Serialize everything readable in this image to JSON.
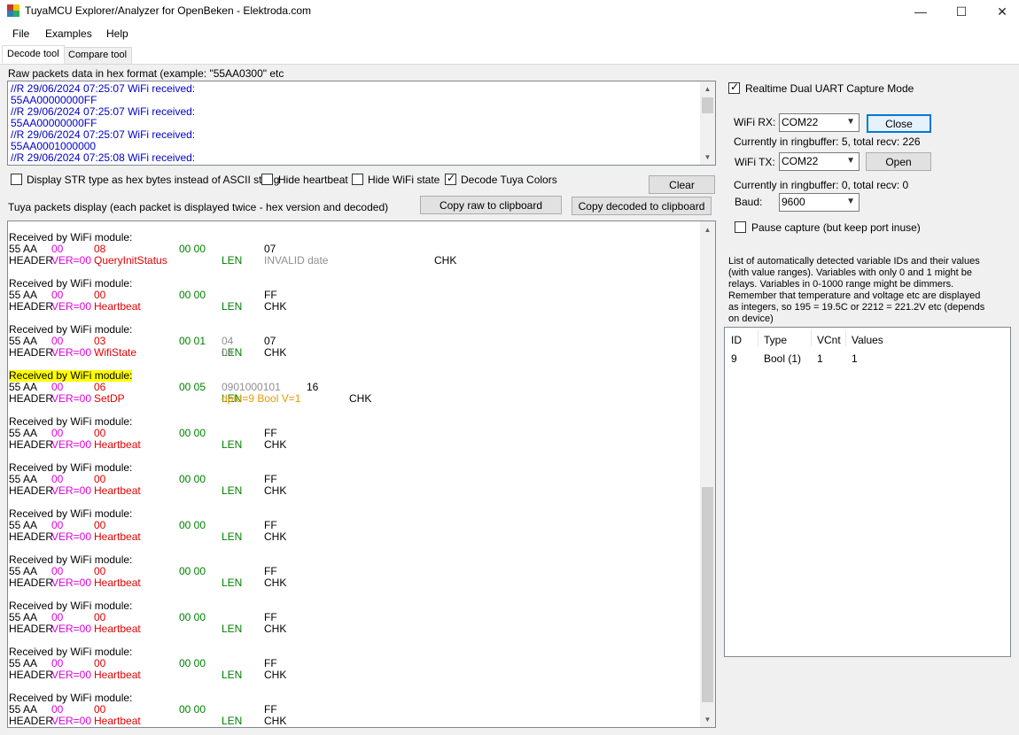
{
  "window": {
    "title": "TuyaMCU Explorer/Analyzer for OpenBeken - Elektroda.com",
    "controls": {
      "minimize": "—",
      "maximize": "☐",
      "close": "✕"
    }
  },
  "menu": [
    "File",
    "Examples",
    "Help"
  ],
  "tabs": [
    "Decode tool",
    "Compare tool"
  ],
  "raw": {
    "label": "Raw packets data in hex format (example: \"55AA0300\" etc",
    "lines": [
      "//R 29/06/2024 07:25:07 WiFi received:",
      "55AA00000000FF",
      "//R 29/06/2024 07:25:07 WiFi received:",
      "55AA00000000FF",
      "//R 29/06/2024 07:25:07 WiFi received:",
      "55AA0001000000",
      "//R 29/06/2024 07:25:08 WiFi received:"
    ]
  },
  "options": {
    "str_hex": "Display STR type as hex bytes instead of ASCII string",
    "hide_heartbeat": "Hide heartbeat",
    "hide_wifi_state": "Hide WiFi state",
    "decode_colors": "Decode Tuya Colors",
    "decode_colors_checked": true
  },
  "buttons": {
    "clear": "Clear",
    "copy_raw": "Copy raw to clipboard",
    "copy_decoded": "Copy decoded to clipboard"
  },
  "packets_label": "Tuya packets display (each packet is displayed twice - hex version and decoded)",
  "packets": [
    {
      "title": "Received by WiFi module:",
      "highlight": false,
      "hex": [
        "55 AA",
        "00",
        "08",
        "00 00",
        "",
        "07",
        ""
      ],
      "dec": [
        "HEADER",
        "VER=00",
        "QueryInitStatus",
        "LEN",
        "INVALID date",
        "",
        "CHK"
      ],
      "layout": "invalid"
    },
    {
      "title": "Received by WiFi module:",
      "highlight": false,
      "hex": [
        "55 AA",
        "00",
        "00",
        "00 00",
        "",
        "FF",
        ""
      ],
      "dec": [
        "HEADER",
        "VER=00",
        "Heartbeat",
        "LEN",
        "",
        "CHK",
        ""
      ],
      "layout": "normal"
    },
    {
      "title": "Received by WiFi module:",
      "highlight": false,
      "hex": [
        "55 AA",
        "00",
        "03",
        "00 01",
        "04",
        "07",
        ""
      ],
      "dec": [
        "HEADER",
        "VER=00",
        "WifiState",
        "LEN",
        "04",
        "CHK",
        ""
      ],
      "layout": "wifi"
    },
    {
      "title": "Received by WiFi module:",
      "highlight": true,
      "hex": [
        "55 AA",
        "00",
        "06",
        "00 05",
        "0901000101",
        "16",
        ""
      ],
      "dec": [
        "HEADER",
        "VER=00",
        "SetDP",
        "LEN",
        "dpId=9 Bool V=1",
        "",
        "CHK"
      ],
      "layout": "setdp"
    },
    {
      "title": "Received by WiFi module:",
      "highlight": false,
      "hex": [
        "55 AA",
        "00",
        "00",
        "00 00",
        "",
        "FF",
        ""
      ],
      "dec": [
        "HEADER",
        "VER=00",
        "Heartbeat",
        "LEN",
        "",
        "CHK",
        ""
      ],
      "layout": "normal"
    },
    {
      "title": "Received by WiFi module:",
      "highlight": false,
      "hex": [
        "55 AA",
        "00",
        "00",
        "00 00",
        "",
        "FF",
        ""
      ],
      "dec": [
        "HEADER",
        "VER=00",
        "Heartbeat",
        "LEN",
        "",
        "CHK",
        ""
      ],
      "layout": "normal"
    },
    {
      "title": "Received by WiFi module:",
      "highlight": false,
      "hex": [
        "55 AA",
        "00",
        "00",
        "00 00",
        "",
        "FF",
        ""
      ],
      "dec": [
        "HEADER",
        "VER=00",
        "Heartbeat",
        "LEN",
        "",
        "CHK",
        ""
      ],
      "layout": "normal"
    },
    {
      "title": "Received by WiFi module:",
      "highlight": false,
      "hex": [
        "55 AA",
        "00",
        "00",
        "00 00",
        "",
        "FF",
        ""
      ],
      "dec": [
        "HEADER",
        "VER=00",
        "Heartbeat",
        "LEN",
        "",
        "CHK",
        ""
      ],
      "layout": "normal"
    },
    {
      "title": "Received by WiFi module:",
      "highlight": false,
      "hex": [
        "55 AA",
        "00",
        "00",
        "00 00",
        "",
        "FF",
        ""
      ],
      "dec": [
        "HEADER",
        "VER=00",
        "Heartbeat",
        "LEN",
        "",
        "CHK",
        ""
      ],
      "layout": "normal"
    },
    {
      "title": "Received by WiFi module:",
      "highlight": false,
      "hex": [
        "55 AA",
        "00",
        "00",
        "00 00",
        "",
        "FF",
        ""
      ],
      "dec": [
        "HEADER",
        "VER=00",
        "Heartbeat",
        "LEN",
        "",
        "CHK",
        ""
      ],
      "layout": "normal"
    },
    {
      "title": "Received by WiFi module:",
      "highlight": false,
      "hex": [
        "55 AA",
        "00",
        "00",
        "00 00",
        "",
        "FF",
        ""
      ],
      "dec": [
        "HEADER",
        "VER=00",
        "Heartbeat",
        "LEN",
        "",
        "CHK",
        ""
      ],
      "layout": "normal"
    }
  ],
  "capture": {
    "realtime_label": "Realtime Dual UART Capture Mode",
    "realtime_checked": true,
    "wifi_rx_label": "WiFi RX:",
    "wifi_rx_port": "COM22",
    "rx_button": "Close",
    "rx_status": "Currently in ringbuffer: 5, total recv: 226",
    "wifi_tx_label": "WiFi TX:",
    "wifi_tx_port": "COM22",
    "tx_button": "Open",
    "tx_status": "Currently in ringbuffer: 0, total recv: 0",
    "baud_label": "Baud:",
    "baud_value": "9600",
    "pause_label": "Pause capture (but keep port inuse)"
  },
  "variables": {
    "description": [
      "List of automatically detected variable IDs  and their values",
      "(with value ranges). Variables with only 0 and 1 might be",
      "relays. Variables in 0-1000 range might be dimmers.",
      "Remember that temperature and voltage etc are displayed",
      "as integers, so 195 = 19.5C or 2212 = 221.2V etc (depends",
      "on device)"
    ],
    "columns": [
      "ID",
      "Type",
      "VCnt",
      "Values"
    ],
    "rows": [
      [
        "9",
        "Bool (1)",
        "1",
        "1"
      ]
    ]
  },
  "colors": {
    "raw_text": "#0000cc",
    "ver": "#e000e0",
    "cmd": "#e00000",
    "len": "#008000",
    "gray": "#909090",
    "dp": "#e69900",
    "highlight": "#ffff00"
  }
}
